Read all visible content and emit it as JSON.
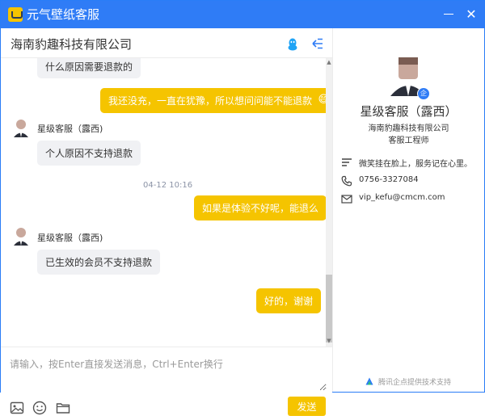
{
  "window": {
    "title": "元气壁纸客服",
    "minimize_label": "—",
    "close_label": "✕"
  },
  "chat": {
    "company": "海南豹趣科技有限公司",
    "messages": [
      {
        "direction": "in",
        "text": "什么原因需要退款的"
      },
      {
        "direction": "out",
        "text": "我还没充，一直在犹豫，所以想问问能不能退款"
      },
      {
        "direction": "in",
        "sender": "星级客服（露西)",
        "text": "个人原因不支持退款"
      },
      {
        "timestamp": "04-12 10:16"
      },
      {
        "direction": "out",
        "text": "如果是体验不好呢，能退么"
      },
      {
        "direction": "in",
        "sender": "星级客服（露西)",
        "text": "已生效的会员不支持退款"
      },
      {
        "direction": "out",
        "text": "好的，谢谢"
      }
    ],
    "emoji_in_message": "😅"
  },
  "compose": {
    "placeholder": "请输入，按Enter直接发送消息，Ctrl+Enter换行",
    "send_label": "发送",
    "tools": [
      "image-icon",
      "emoji-icon",
      "folder-icon"
    ]
  },
  "profile": {
    "name": "星级客服（露西）",
    "company": "海南豹趣科技有限公司",
    "role": "客服工程师",
    "badge": "企",
    "motto": "微笑挂在脸上，服务记在心里。",
    "phone": "0756-3327084",
    "email": "vip_kefu@cmcm.com"
  },
  "footer": {
    "text": "腾讯企点提供技术支持"
  },
  "colors": {
    "titlebar": "#2f7cf6",
    "accent": "#f5c400",
    "incoming_bubble": "#f0f1f4"
  }
}
